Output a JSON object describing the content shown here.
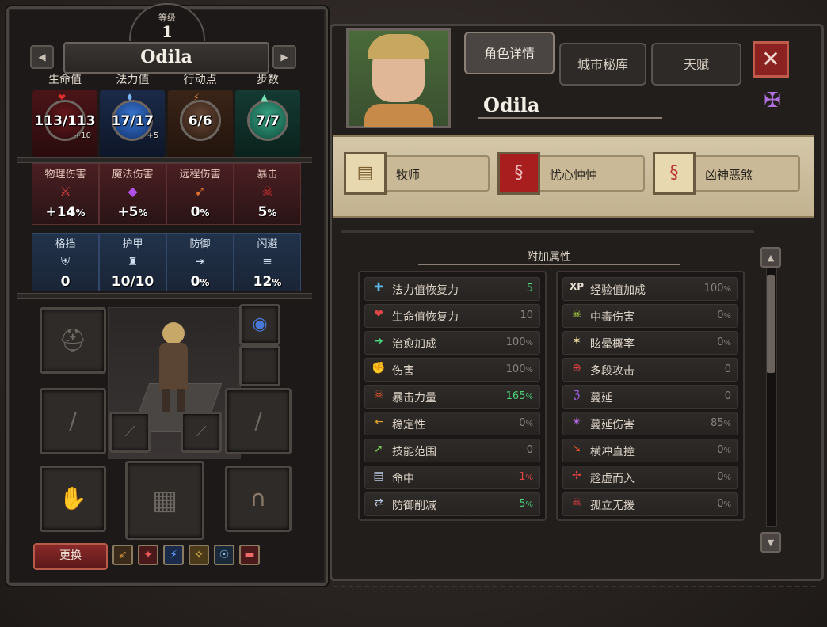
{
  "level": {
    "label": "等级",
    "value": "1"
  },
  "character": {
    "name": "Odila"
  },
  "stats_top": [
    {
      "title": "生命值",
      "value": "113/113",
      "sub": "+10",
      "icon": "heart-icon",
      "color": "#b8222a"
    },
    {
      "title": "法力值",
      "value": "17/17",
      "sub": "+5",
      "icon": "mana-drop-icon",
      "color": "#2a68c8"
    },
    {
      "title": "行动点",
      "value": "6/6",
      "sub": "",
      "icon": "lightning-icon",
      "color": "#c87838"
    },
    {
      "title": "步数",
      "value": "7/7",
      "sub": "",
      "icon": "boot-icon",
      "color": "#2a9a78"
    }
  ],
  "damage_stats": [
    {
      "title": "物理伤害",
      "value": "+14",
      "unit": "%",
      "icon": "sword-icon"
    },
    {
      "title": "魔法伤害",
      "value": "+5",
      "unit": "%",
      "icon": "crystal-icon"
    },
    {
      "title": "远程伤害",
      "value": "0",
      "unit": "%",
      "icon": "arrow-icon"
    },
    {
      "title": "暴击",
      "value": "5",
      "unit": "%",
      "icon": "skull-icon"
    }
  ],
  "defense_stats": [
    {
      "title": "格挡",
      "value": "0",
      "unit": "",
      "icon": "shield-icon"
    },
    {
      "title": "护甲",
      "value": "10/10",
      "unit": "",
      "icon": "armor-icon"
    },
    {
      "title": "防御",
      "value": "0",
      "unit": "%",
      "icon": "defense-icon"
    },
    {
      "title": "闪避",
      "value": "12",
      "unit": "%",
      "icon": "dodge-icon"
    }
  ],
  "swap_button": "更换",
  "tabs": [
    {
      "label": "角色详情",
      "active": true
    },
    {
      "label": "城市秘库",
      "active": false
    },
    {
      "label": "天赋",
      "active": false
    }
  ],
  "traits": [
    {
      "label": "牧师",
      "icon": "scroll-icon",
      "bg": "#d8c8a0"
    },
    {
      "label": "忧心忡忡",
      "icon": "dna-icon",
      "bg": "#a81e1e"
    },
    {
      "label": "凶神恶煞",
      "icon": "dna-icon",
      "bg": "#d8c8a0"
    }
  ],
  "attributes": {
    "header": "附加属性",
    "left": [
      {
        "label": "法力值恢复力",
        "value": "5",
        "unit": "",
        "tone": "pos",
        "icon": "mana-regen-icon"
      },
      {
        "label": "生命值恢复力",
        "value": "10",
        "unit": "",
        "tone": "neutral",
        "icon": "health-regen-icon"
      },
      {
        "label": "治愈加成",
        "value": "100",
        "unit": "%",
        "tone": "neutral",
        "icon": "healing-icon"
      },
      {
        "label": "伤害",
        "value": "100",
        "unit": "%",
        "tone": "neutral",
        "icon": "damage-fist-icon"
      },
      {
        "label": "暴击力量",
        "value": "165",
        "unit": "%",
        "tone": "pos",
        "icon": "crit-power-icon"
      },
      {
        "label": "稳定性",
        "value": "0",
        "unit": "%",
        "tone": "neutral",
        "icon": "stability-icon"
      },
      {
        "label": "技能范围",
        "value": "0",
        "unit": "",
        "tone": "neutral",
        "icon": "skill-range-icon"
      },
      {
        "label": "命中",
        "value": "-1",
        "unit": "%",
        "tone": "neg",
        "icon": "accuracy-icon"
      },
      {
        "label": "防御削减",
        "value": "5",
        "unit": "%",
        "tone": "pos",
        "icon": "armor-pierce-icon"
      }
    ],
    "right": [
      {
        "label": "经验值加成",
        "value": "100",
        "unit": "%",
        "tone": "neutral",
        "icon": "xp-icon",
        "glyph": "XP"
      },
      {
        "label": "中毒伤害",
        "value": "0",
        "unit": "%",
        "tone": "neutral",
        "icon": "poison-icon"
      },
      {
        "label": "眩晕概率",
        "value": "0",
        "unit": "%",
        "tone": "neutral",
        "icon": "stun-stars-icon"
      },
      {
        "label": "多段攻击",
        "value": "0",
        "unit": "",
        "tone": "neutral",
        "icon": "crosshair-icon"
      },
      {
        "label": "蔓延",
        "value": "0",
        "unit": "",
        "tone": "neutral",
        "icon": "spread-icon"
      },
      {
        "label": "蔓延伤害",
        "value": "85",
        "unit": "%",
        "tone": "neutral",
        "icon": "spread-damage-icon"
      },
      {
        "label": "横冲直撞",
        "value": "0",
        "unit": "%",
        "tone": "neutral",
        "icon": "charge-icon"
      },
      {
        "label": "趁虚而入",
        "value": "0",
        "unit": "%",
        "tone": "neutral",
        "icon": "opportunity-icon"
      },
      {
        "label": "孤立无援",
        "value": "0",
        "unit": "%",
        "tone": "neutral",
        "icon": "isolated-skull-icon"
      }
    ]
  },
  "skills": [
    {
      "icon": "spear-skill-icon",
      "color": "#c88a30"
    },
    {
      "icon": "blood-sword-skill-icon",
      "color": "#c82a2a"
    },
    {
      "icon": "lightning-blade-skill-icon",
      "color": "#3a68d8"
    },
    {
      "icon": "holy-strike-skill-icon",
      "color": "#d8b030"
    },
    {
      "icon": "spirit-skill-icon",
      "color": "#4a8ab8"
    },
    {
      "icon": "red-charm-skill-icon",
      "color": "#c83030"
    }
  ]
}
